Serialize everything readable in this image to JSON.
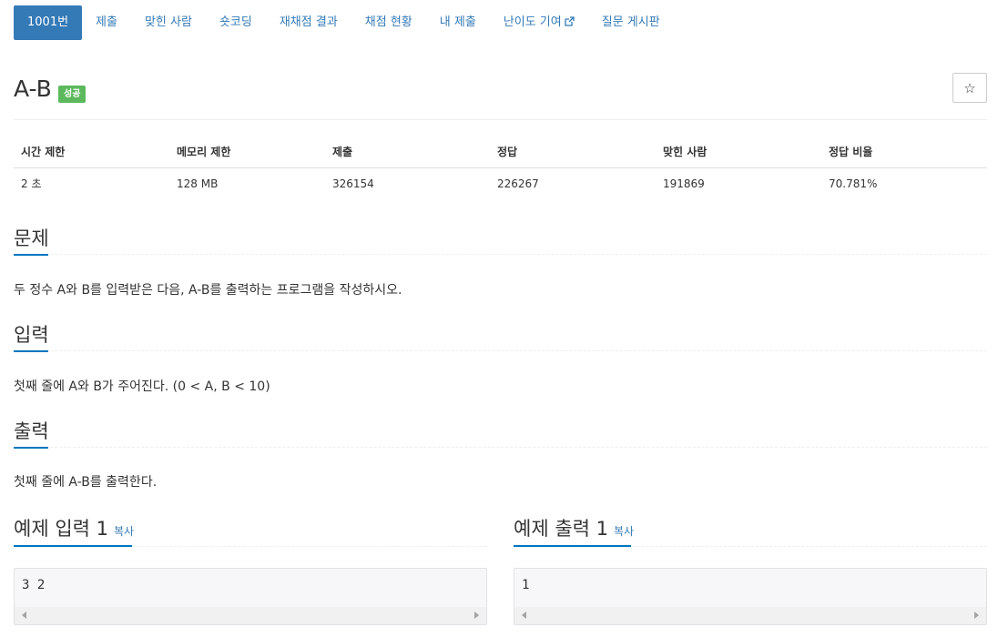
{
  "tabs": [
    {
      "label": "1001번",
      "active": true
    },
    {
      "label": "제출"
    },
    {
      "label": "맞힌 사람"
    },
    {
      "label": "숏코딩"
    },
    {
      "label": "재채점 결과"
    },
    {
      "label": "채점 현황"
    },
    {
      "label": "내 제출"
    },
    {
      "label": "난이도 기여"
    },
    {
      "label": "질문 게시판"
    }
  ],
  "problem": {
    "title": "A-B",
    "badge": "성공",
    "star_icon": "☆"
  },
  "info": {
    "headers": [
      "시간 제한",
      "메모리 제한",
      "제출",
      "정답",
      "맞힌 사람",
      "정답 비율"
    ],
    "values": [
      "2 초",
      "128 MB",
      "326154",
      "226267",
      "191869",
      "70.781%"
    ]
  },
  "sections": {
    "problem": {
      "title": "문제",
      "text": "두 정수 A와 B를 입력받은 다음, A-B를 출력하는 프로그램을 작성하시오."
    },
    "input": {
      "title": "입력",
      "text": "첫째 줄에 A와 B가 주어진다. (0 < A, B < 10)"
    },
    "output": {
      "title": "출력",
      "text": "첫째 줄에 A-B를 출력한다."
    }
  },
  "samples": {
    "input": {
      "title": "예제 입력 1",
      "copy": "복사",
      "value": "3 2"
    },
    "output": {
      "title": "예제 출력 1",
      "copy": "복사",
      "value": "1"
    }
  },
  "colors": {
    "accent": "#337ab7",
    "success": "#5cb85c",
    "underline": "#0076c0"
  }
}
